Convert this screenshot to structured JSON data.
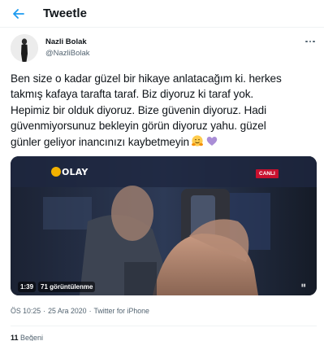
{
  "header": {
    "title": "Tweetle",
    "back_icon": "arrow-left-icon",
    "accent_color": "#1d9bf0"
  },
  "author": {
    "name": "Nazli Bolak",
    "handle": "@NazliBolak",
    "more_icon": "more-dots-icon"
  },
  "tweet": {
    "lines": [
      "Ben size o kadar güzel bir hikaye anlatacağım ki. herkes",
      "takmış kafaya taraf​ta taraf. Biz diyoruz ki taraf yok.",
      "Hepimiz bir olduk diyoruz. Bize güvenin diyoruz. Hadi",
      "güvenmiyorsunuz bekleyin görün diyoruz yahu. güzel",
      "günler geliyor inancınızı kaybetmeyin"
    ],
    "emojis": [
      "hugging-face-emoji",
      "purple-heart-emoji"
    ]
  },
  "video": {
    "channel_logo": "OLAY",
    "live_label": "CANLI",
    "duration": "1:39",
    "views": "71 görüntülenme"
  },
  "meta": {
    "time": "ÖS 10:25",
    "separator": "·",
    "date": "25 Ara 2020",
    "source": "Twitter for iPhone"
  },
  "stats": {
    "likes_count": "11",
    "likes_label": "Beğeni"
  }
}
